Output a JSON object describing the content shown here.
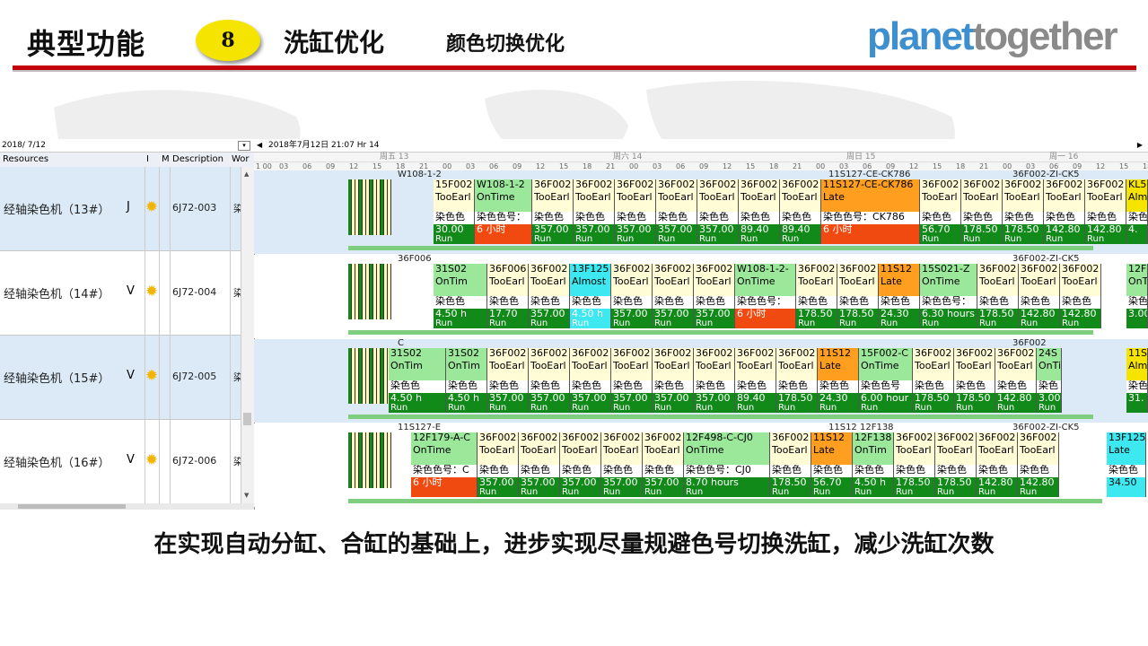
{
  "slide": {
    "title": "典型功能",
    "number": "8",
    "subtitle": "洗缸优化",
    "subtitle2": "颜色切换优化",
    "logo_part1": "planet",
    "logo_part2": "together",
    "caption": "在实现自动分缸、合缸的基础上，进步实现尽量规避色号切换洗缸，减少洗缸次数",
    "colors": {
      "accent_red": "#c3000b",
      "badge_yellow": "#f5e400",
      "logo_blue": "#3d8fcf",
      "logo_gray": "#8a8a8a"
    }
  },
  "left_panel": {
    "date_value": "2018/  7/12",
    "columns": [
      "Resources",
      "I",
      "M",
      "Description",
      "Wor"
    ],
    "rows": [
      {
        "name": "经轴染色机（13#）",
        "flag": "J",
        "desc": "6J72-003",
        "wo": "染"
      },
      {
        "name": "经轴染色机（14#）",
        "flag": "V",
        "desc": "6J72-004",
        "wo": "染"
      },
      {
        "name": "经轴染色机（15#）",
        "flag": "V",
        "desc": "6J72-005",
        "wo": "染"
      },
      {
        "name": "经轴染色机（16#）",
        "flag": "V",
        "desc": "6J72-006",
        "wo": "染"
      }
    ]
  },
  "gantt": {
    "header_date": "2018年7月12日  21:07   Hr 14",
    "day_labels": [
      "周五 13",
      "周六 14",
      "周日 15",
      "周一 16"
    ],
    "hour_labels": [
      "1 00",
      "03",
      "06",
      "09",
      "12",
      "15",
      "18",
      "21",
      "00",
      "03",
      "06",
      "09",
      "12",
      "15",
      "18",
      "21",
      "00",
      "03",
      "06",
      "09",
      "12",
      "15",
      "18",
      "21",
      "00",
      "03",
      "06",
      "09",
      "12",
      "15",
      "18",
      "21",
      "00",
      "03",
      "06",
      "09",
      "12",
      "15",
      "18"
    ],
    "lanes": [
      {
        "top_label": "W108-1-2",
        "top_label2": "11S127-CE-CK786",
        "top_label3": "36F002-ZI-CK5",
        "blocks": [
          {
            "w": 46,
            "bg": "#fffcd6",
            "id": "15F002",
            "st": "TooEarl",
            "dye": "染色色",
            "run": "30.00",
            "rc": "#118a1a",
            "t": "Run"
          },
          {
            "w": 64,
            "bg": "#9be89b",
            "id": "W108-1-2",
            "st": "OnTime",
            "dye": "染色色号：",
            "run": "6 小时",
            "rc": "#f04a10",
            "t": ""
          },
          {
            "w": 46,
            "bg": "#fffcd6",
            "id": "36F002",
            "st": "TooEarl",
            "dye": "染色色",
            "run": "357.00",
            "rc": "#118a1a",
            "t": "Run"
          },
          {
            "w": 46,
            "bg": "#fffcd6",
            "id": "36F002",
            "st": "TooEarl",
            "dye": "染色色",
            "run": "357.00",
            "rc": "#118a1a",
            "t": "Run"
          },
          {
            "w": 46,
            "bg": "#fffcd6",
            "id": "36F002",
            "st": "TooEarl",
            "dye": "染色色",
            "run": "357.00",
            "rc": "#118a1a",
            "t": "Run"
          },
          {
            "w": 46,
            "bg": "#fffcd6",
            "id": "36F002",
            "st": "TooEarl",
            "dye": "染色色",
            "run": "357.00",
            "rc": "#118a1a",
            "t": "Run"
          },
          {
            "w": 46,
            "bg": "#fffcd6",
            "id": "36F002",
            "st": "TooEarl",
            "dye": "染色色",
            "run": "357.00",
            "rc": "#118a1a",
            "t": "Run"
          },
          {
            "w": 46,
            "bg": "#fffcd6",
            "id": "36F002",
            "st": "TooEarl",
            "dye": "染色色",
            "run": "89.40",
            "rc": "#118a1a",
            "t": "Run"
          },
          {
            "w": 46,
            "bg": "#fffcd6",
            "id": "36F002",
            "st": "TooEarl",
            "dye": "染色色",
            "run": "89.40",
            "rc": "#118a1a",
            "t": "Run"
          },
          {
            "w": 110,
            "bg": "#ff9e1f",
            "id": "11S127-CE-CK786",
            "st": "Late",
            "dye": "染色色号：CK786",
            "run": "6 小时",
            "rc": "#f04a10",
            "t": ""
          },
          {
            "w": 46,
            "bg": "#fffcd6",
            "id": "36F002",
            "st": "TooEarl",
            "dye": "染色色",
            "run": "56.70",
            "rc": "#118a1a",
            "t": "Run"
          },
          {
            "w": 46,
            "bg": "#fffcd6",
            "id": "36F002",
            "st": "TooEarl",
            "dye": "染色色",
            "run": "178.50",
            "rc": "#118a1a",
            "t": "Run"
          },
          {
            "w": 46,
            "bg": "#fffcd6",
            "id": "36F002",
            "st": "TooEarl",
            "dye": "染色色",
            "run": "178.50",
            "rc": "#118a1a",
            "t": "Run"
          },
          {
            "w": 46,
            "bg": "#fffcd6",
            "id": "36F002",
            "st": "TooEarl",
            "dye": "染色色",
            "run": "142.80",
            "rc": "#118a1a",
            "t": "Run"
          },
          {
            "w": 46,
            "bg": "#fffcd6",
            "id": "36F002",
            "st": "TooEarl",
            "dye": "染色色",
            "run": "142.80",
            "rc": "#118a1a",
            "t": "Run"
          }
        ],
        "tail": {
          "id": "KL5",
          "st": "Almo",
          "dye": "染色",
          "run": "4.",
          "bg": "#f5e400"
        }
      },
      {
        "top_label": "36F006",
        "top_label2": "",
        "top_label3": "36F002-ZI-CK5",
        "blocks": [
          {
            "w": 60,
            "bg": "#9be89b",
            "id": "31S02",
            "st": "OnTim",
            "dye": "染色色",
            "run": "4.50 h",
            "rc": "#118a1a",
            "t": "Run"
          },
          {
            "w": 46,
            "bg": "#fffcd6",
            "id": "36F006",
            "st": "TooEarl",
            "dye": "染色色",
            "run": "17.70",
            "rc": "#118a1a",
            "t": "Run"
          },
          {
            "w": 46,
            "bg": "#fffcd6",
            "id": "36F002",
            "st": "TooEarl",
            "dye": "染色色",
            "run": "357.00",
            "rc": "#118a1a",
            "t": "Run"
          },
          {
            "w": 46,
            "bg": "#3de8f0",
            "id": "13F125",
            "st": "Almost",
            "dye": "染色色",
            "run": "4.50 h",
            "rc": "#3de8f0",
            "t": "Run"
          },
          {
            "w": 46,
            "bg": "#fffcd6",
            "id": "36F002",
            "st": "TooEarl",
            "dye": "染色色",
            "run": "357.00",
            "rc": "#118a1a",
            "t": "Run"
          },
          {
            "w": 46,
            "bg": "#fffcd6",
            "id": "36F002",
            "st": "TooEarl",
            "dye": "染色色",
            "run": "357.00",
            "rc": "#118a1a",
            "t": "Run"
          },
          {
            "w": 46,
            "bg": "#fffcd6",
            "id": "36F002",
            "st": "TooEarl",
            "dye": "染色色",
            "run": "357.00",
            "rc": "#118a1a",
            "t": "Run"
          },
          {
            "w": 68,
            "bg": "#9be89b",
            "id": "W108-1-2-",
            "st": "OnTime",
            "dye": "染色色号：",
            "run": "6 小时",
            "rc": "#f04a10",
            "t": ""
          },
          {
            "w": 46,
            "bg": "#fffcd6",
            "id": "36F002",
            "st": "TooEarl",
            "dye": "染色色",
            "run": "178.50",
            "rc": "#118a1a",
            "t": "Run"
          },
          {
            "w": 46,
            "bg": "#fffcd6",
            "id": "36F002",
            "st": "TooEarl",
            "dye": "染色色",
            "run": "178.50",
            "rc": "#118a1a",
            "t": "Run"
          },
          {
            "w": 46,
            "bg": "#ff9e1f",
            "id": "11S12",
            "st": "Late",
            "dye": "染色色",
            "run": "24.30",
            "rc": "#118a1a",
            "t": "Run"
          },
          {
            "w": 64,
            "bg": "#9be89b",
            "id": "15S021-Z",
            "st": "OnTime",
            "dye": "染色色号：",
            "run": "6.30 hours",
            "rc": "#118a1a",
            "t": "Run"
          },
          {
            "w": 46,
            "bg": "#fffcd6",
            "id": "36F002",
            "st": "TooEarl",
            "dye": "染色色",
            "run": "178.50",
            "rc": "#118a1a",
            "t": "Run"
          },
          {
            "w": 46,
            "bg": "#fffcd6",
            "id": "36F002",
            "st": "TooEarl",
            "dye": "染色色",
            "run": "142.80",
            "rc": "#118a1a",
            "t": "Run"
          },
          {
            "w": 46,
            "bg": "#fffcd6",
            "id": "36F002",
            "st": "TooEarl",
            "dye": "染色色",
            "run": "142.80",
            "rc": "#118a1a",
            "t": "Run"
          }
        ],
        "tail": {
          "id": "12F",
          "st": "OnTi",
          "dye": "染色",
          "run": "3.00",
          "bg": "#9be89b"
        }
      },
      {
        "top_label": "C",
        "top_label2": "",
        "top_label3": "36F002",
        "blocks": [
          {
            "w": 64,
            "bg": "#9be89b",
            "id": "31S02",
            "st": "OnTim",
            "dye": "染色色",
            "run": "4.50 h",
            "rc": "#118a1a",
            "t": "Run"
          },
          {
            "w": 46,
            "bg": "#9be89b",
            "id": "31S02",
            "st": "OnTim",
            "dye": "染色色",
            "run": "4.50 h",
            "rc": "#118a1a",
            "t": "Run"
          },
          {
            "w": 46,
            "bg": "#fffcd6",
            "id": "36F002",
            "st": "TooEarl",
            "dye": "染色色",
            "run": "357.00",
            "rc": "#118a1a",
            "t": "Run"
          },
          {
            "w": 46,
            "bg": "#fffcd6",
            "id": "36F002",
            "st": "TooEarl",
            "dye": "染色色",
            "run": "357.00",
            "rc": "#118a1a",
            "t": "Run"
          },
          {
            "w": 46,
            "bg": "#fffcd6",
            "id": "36F002",
            "st": "TooEarl",
            "dye": "染色色",
            "run": "357.00",
            "rc": "#118a1a",
            "t": "Run"
          },
          {
            "w": 46,
            "bg": "#fffcd6",
            "id": "36F002",
            "st": "TooEarl",
            "dye": "染色色",
            "run": "357.00",
            "rc": "#118a1a",
            "t": "Run"
          },
          {
            "w": 46,
            "bg": "#fffcd6",
            "id": "36F002",
            "st": "TooEarl",
            "dye": "染色色",
            "run": "357.00",
            "rc": "#118a1a",
            "t": "Run"
          },
          {
            "w": 46,
            "bg": "#fffcd6",
            "id": "36F002",
            "st": "TooEarl",
            "dye": "染色色",
            "run": "357.00",
            "rc": "#118a1a",
            "t": "Run"
          },
          {
            "w": 46,
            "bg": "#fffcd6",
            "id": "36F002",
            "st": "TooEarl",
            "dye": "染色色",
            "run": "89.40",
            "rc": "#118a1a",
            "t": "Run"
          },
          {
            "w": 46,
            "bg": "#fffcd6",
            "id": "36F002",
            "st": "TooEarl",
            "dye": "染色色",
            "run": "178.50",
            "rc": "#118a1a",
            "t": "Run"
          },
          {
            "w": 46,
            "bg": "#ff9e1f",
            "id": "11S12",
            "st": "Late",
            "dye": "染色色",
            "run": "24.30",
            "rc": "#118a1a",
            "t": "Run"
          },
          {
            "w": 60,
            "bg": "#9be89b",
            "id": "15F002-C",
            "st": "OnTime",
            "dye": "染色色号",
            "run": "6.00 hour",
            "rc": "#118a1a",
            "t": "Run"
          },
          {
            "w": 46,
            "bg": "#fffcd6",
            "id": "36F002",
            "st": "TooEarl",
            "dye": "染色色",
            "run": "178.50",
            "rc": "#118a1a",
            "t": "Run"
          },
          {
            "w": 46,
            "bg": "#fffcd6",
            "id": "36F002",
            "st": "TooEarl",
            "dye": "染色色",
            "run": "178.50",
            "rc": "#118a1a",
            "t": "Run"
          },
          {
            "w": 46,
            "bg": "#fffcd6",
            "id": "36F002",
            "st": "TooEarl",
            "dye": "染色色",
            "run": "142.80",
            "rc": "#118a1a",
            "t": "Run"
          },
          {
            "w": 28,
            "bg": "#9be89b",
            "id": "24S",
            "st": "OnTi",
            "dye": "染色",
            "run": "3.00",
            "rc": "#118a1a",
            "t": "Run"
          }
        ],
        "tail": {
          "id": "11S",
          "st": "Almo",
          "dye": "染色",
          "run": "31.",
          "bg": "#f5e400"
        }
      },
      {
        "top_label": "11S127-E",
        "top_label2": "11S12  12F138",
        "top_label3": "36F002-ZI-CK5",
        "blocks": [
          {
            "w": 74,
            "bg": "#9be89b",
            "id": "12F179-A-C",
            "st": "OnTime",
            "dye": "染色色号：C",
            "run": "6 小时",
            "rc": "#f04a10",
            "t": ""
          },
          {
            "w": 46,
            "bg": "#fffcd6",
            "id": "36F002",
            "st": "TooEarl",
            "dye": "染色色",
            "run": "357.00",
            "rc": "#118a1a",
            "t": "Run"
          },
          {
            "w": 46,
            "bg": "#fffcd6",
            "id": "36F002",
            "st": "TooEarl",
            "dye": "染色色",
            "run": "357.00",
            "rc": "#118a1a",
            "t": "Run"
          },
          {
            "w": 46,
            "bg": "#fffcd6",
            "id": "36F002",
            "st": "TooEarl",
            "dye": "染色色",
            "run": "357.00",
            "rc": "#118a1a",
            "t": "Run"
          },
          {
            "w": 46,
            "bg": "#fffcd6",
            "id": "36F002",
            "st": "TooEarl",
            "dye": "染色色",
            "run": "357.00",
            "rc": "#118a1a",
            "t": "Run"
          },
          {
            "w": 46,
            "bg": "#fffcd6",
            "id": "36F002",
            "st": "TooEarl",
            "dye": "染色色",
            "run": "357.00",
            "rc": "#118a1a",
            "t": "Run"
          },
          {
            "w": 96,
            "bg": "#9be89b",
            "id": "12F498-C-CJ0",
            "st": "OnTime",
            "dye": "染色色号：CJ0",
            "run": "8.70 hours",
            "rc": "#118a1a",
            "t": "Run"
          },
          {
            "w": 46,
            "bg": "#fffcd6",
            "id": "36F002",
            "st": "TooEarl",
            "dye": "染色色",
            "run": "178.50",
            "rc": "#118a1a",
            "t": "Run"
          },
          {
            "w": 46,
            "bg": "#ff9e1f",
            "id": "11S12",
            "st": "Late",
            "dye": "染色色",
            "run": "56.70",
            "rc": "#118a1a",
            "t": "Run"
          },
          {
            "w": 46,
            "bg": "#9be89b",
            "id": "12F138",
            "st": "OnTim",
            "dye": "染色色",
            "run": "4.50 h",
            "rc": "#118a1a",
            "t": "Run"
          },
          {
            "w": 46,
            "bg": "#fffcd6",
            "id": "36F002",
            "st": "TooEarl",
            "dye": "染色色",
            "run": "178.50",
            "rc": "#118a1a",
            "t": "Run"
          },
          {
            "w": 46,
            "bg": "#fffcd6",
            "id": "36F002",
            "st": "TooEarl",
            "dye": "染色色",
            "run": "178.50",
            "rc": "#118a1a",
            "t": "Run"
          },
          {
            "w": 46,
            "bg": "#fffcd6",
            "id": "36F002",
            "st": "TooEarl",
            "dye": "染色色",
            "run": "142.80",
            "rc": "#118a1a",
            "t": "Run"
          },
          {
            "w": 46,
            "bg": "#fffcd6",
            "id": "36F002",
            "st": "TooEarl",
            "dye": "染色色",
            "run": "142.80",
            "rc": "#118a1a",
            "t": "Run"
          }
        ],
        "tail": {
          "id": "13F125",
          "st": "Late",
          "dye": "染色色",
          "run": "34.50",
          "bg": "#3de8f0"
        }
      }
    ]
  }
}
